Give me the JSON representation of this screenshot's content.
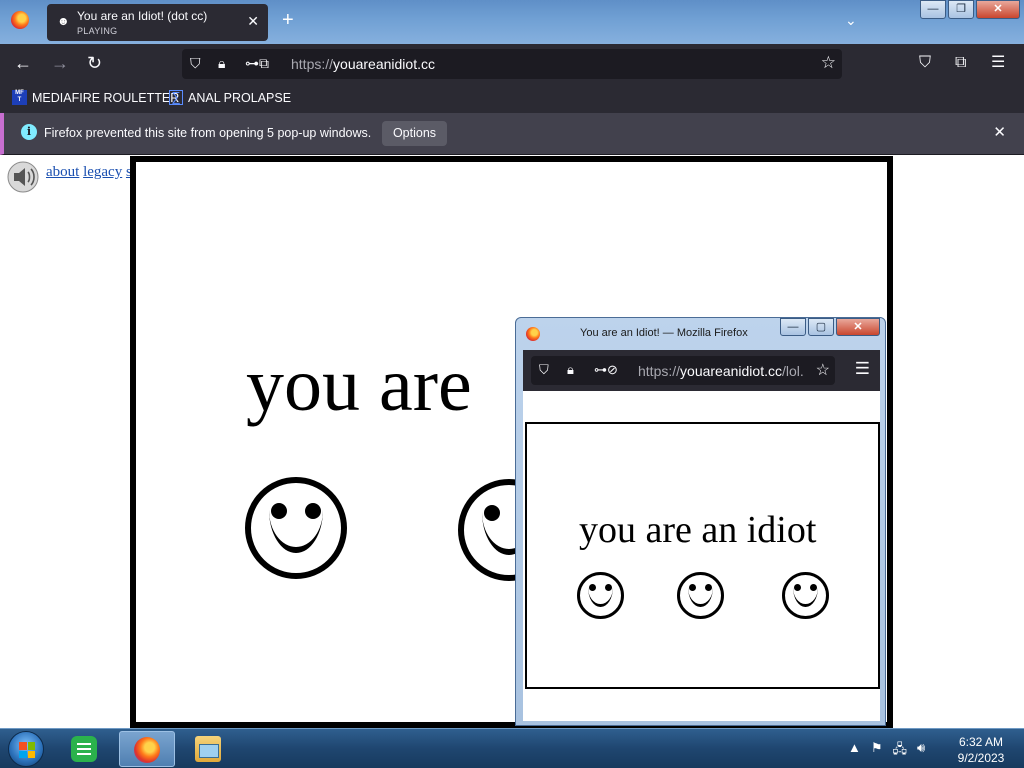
{
  "browser": {
    "tab": {
      "title": "You are an Idiot! (dot cc)",
      "status": "PLAYING",
      "icon": "smiley-icon"
    },
    "url": {
      "scheme": "https://",
      "host": "youareanidiot.cc"
    },
    "bookmarks": [
      {
        "label": "MEDIAFIRE ROULETTER",
        "icon": "mediafire-icon",
        "icon_text": "MF\nT"
      },
      {
        "label": "ANAL PROLAPSE",
        "icon": "sigma-icon",
        "icon_text": "∑"
      }
    ],
    "notification": {
      "message": "Firefox prevented this site from opening 5 pop-up windows.",
      "options_label": "Options"
    }
  },
  "page": {
    "links": [
      {
        "label": "about"
      },
      {
        "label": "legacy"
      },
      {
        "label": "safe"
      }
    ],
    "headline": "you are"
  },
  "popup": {
    "window_title": "You are an Idiot! — Mozilla Firefox",
    "url": {
      "scheme": "https://",
      "host": "youareanidiot.cc",
      "path": "/lol."
    },
    "headline": "you are an idiot"
  },
  "taskbar": {
    "time": "6:32 AM",
    "date": "9/2/2023"
  },
  "colors": {
    "chrome_dark": "#2b2a33",
    "urlbar": "#1c1b22",
    "notification_bg": "#42414d",
    "notification_accent": "#c86fd1",
    "link": "#1a4fb0"
  }
}
